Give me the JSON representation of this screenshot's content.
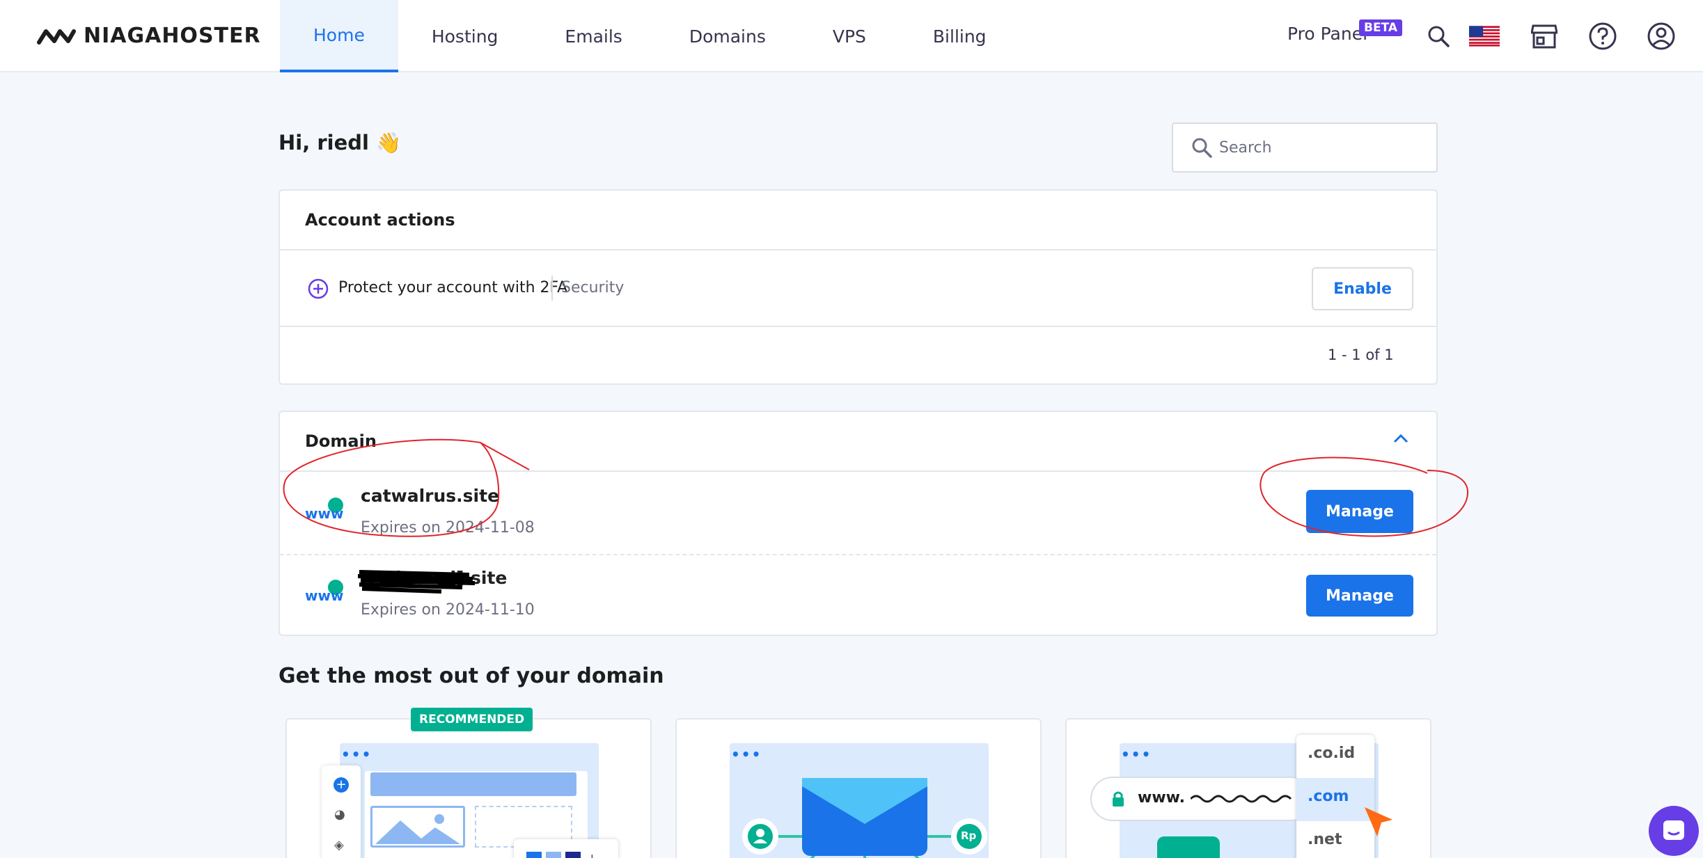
{
  "header": {
    "logo_text": "NIAGAHOSTER",
    "nav": [
      "Home",
      "Hosting",
      "Emails",
      "Domains",
      "VPS",
      "Billing"
    ],
    "active_nav": "Home",
    "pro_panel": "Pro Panel",
    "beta": "BETA",
    "icons": [
      "search-icon",
      "us-flag-icon",
      "store-icon",
      "help-icon",
      "account-icon"
    ]
  },
  "greeting": "Hi, riedl 👋",
  "search": {
    "placeholder": "Search"
  },
  "account_actions": {
    "title": "Account actions",
    "item_text": "Protect your account with 2FA",
    "item_tag": "Security",
    "button": "Enable",
    "pagination": "1 - 1 of 1"
  },
  "domain": {
    "title": "Domain",
    "items": [
      {
        "name": "catwalrus.site",
        "expires": "Expires on 2024-11-08",
        "button": "Manage"
      },
      {
        "name": "[redacted].site",
        "expires": "Expires on 2024-11-10",
        "button": "Manage"
      }
    ]
  },
  "promo": {
    "title": "Get the most out of your domain",
    "badge": "RECOMMENDED",
    "tlds": [
      ".co.id",
      ".com",
      ".net"
    ],
    "www": "www.",
    "rp": "Rp"
  },
  "colors": {
    "primary": "#1a73e8",
    "purple": "#673de6",
    "green": "#00b090",
    "annotation": "#e0242a"
  }
}
